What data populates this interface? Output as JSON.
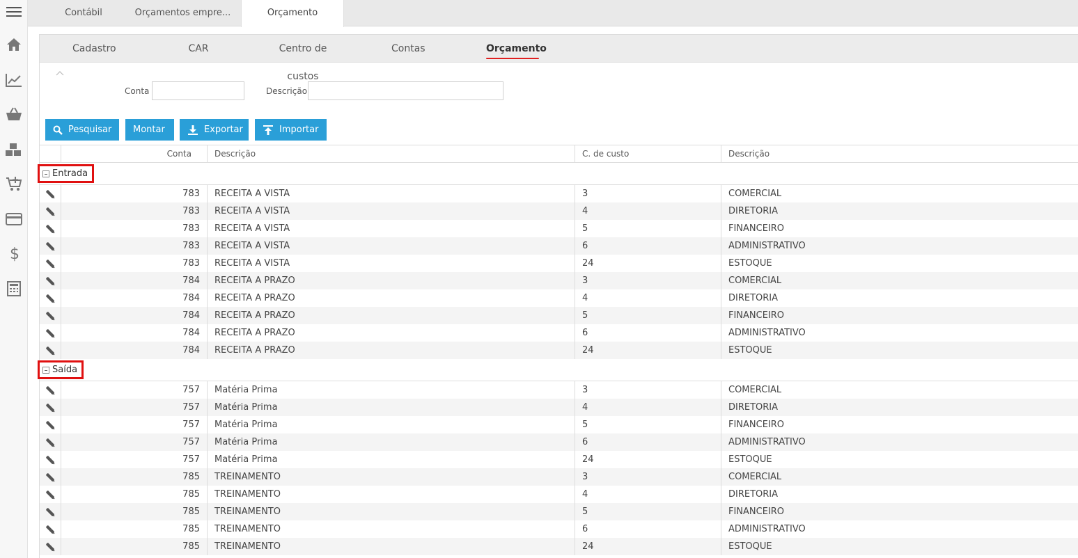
{
  "top_tabs": [
    {
      "label": "Contábil",
      "active": false
    },
    {
      "label": "Orçamentos empre...",
      "active": false
    },
    {
      "label": "Orçamento",
      "active": true
    }
  ],
  "sub_tabs": [
    {
      "label": "Cadastro",
      "active": false
    },
    {
      "label": "CAR",
      "active": false
    },
    {
      "label": "Centro de custos",
      "active": false
    },
    {
      "label": "Contas",
      "active": false
    },
    {
      "label": "Orçamento",
      "active": true
    }
  ],
  "sidebar_icons": [
    "menu-icon",
    "home-icon",
    "chart-icon",
    "basket-icon",
    "boxes-icon",
    "cart-plus-icon",
    "credit-card-icon",
    "dollar-icon",
    "calculator-icon"
  ],
  "filters": {
    "conta_label": "Conta",
    "conta_value": "",
    "descricao_label": "Descrição",
    "descricao_value": ""
  },
  "buttons": {
    "pesquisar": "Pesquisar",
    "montar": "Montar",
    "exportar": "Exportar",
    "importar": "Importar"
  },
  "colors": {
    "accent": "#2a9fd8",
    "highlight": "#e01010"
  },
  "columns": [
    "Conta",
    "Descrição",
    "C. de custo",
    "Descrição"
  ],
  "groups": [
    {
      "label": "Entrada",
      "rows": [
        {
          "conta": "783",
          "descricao": "RECEITA A VISTA",
          "custo": "3",
          "custo_desc": "COMERCIAL"
        },
        {
          "conta": "783",
          "descricao": "RECEITA A VISTA",
          "custo": "4",
          "custo_desc": "DIRETORIA"
        },
        {
          "conta": "783",
          "descricao": "RECEITA A VISTA",
          "custo": "5",
          "custo_desc": "FINANCEIRO"
        },
        {
          "conta": "783",
          "descricao": "RECEITA A VISTA",
          "custo": "6",
          "custo_desc": "ADMINISTRATIVO"
        },
        {
          "conta": "783",
          "descricao": "RECEITA A VISTA",
          "custo": "24",
          "custo_desc": "ESTOQUE"
        },
        {
          "conta": "784",
          "descricao": "RECEITA A PRAZO",
          "custo": "3",
          "custo_desc": "COMERCIAL"
        },
        {
          "conta": "784",
          "descricao": "RECEITA A PRAZO",
          "custo": "4",
          "custo_desc": "DIRETORIA"
        },
        {
          "conta": "784",
          "descricao": "RECEITA A PRAZO",
          "custo": "5",
          "custo_desc": "FINANCEIRO"
        },
        {
          "conta": "784",
          "descricao": "RECEITA A PRAZO",
          "custo": "6",
          "custo_desc": "ADMINISTRATIVO"
        },
        {
          "conta": "784",
          "descricao": "RECEITA A PRAZO",
          "custo": "24",
          "custo_desc": "ESTOQUE"
        }
      ]
    },
    {
      "label": "Saída",
      "rows": [
        {
          "conta": "757",
          "descricao": "Matéria Prima",
          "custo": "3",
          "custo_desc": "COMERCIAL"
        },
        {
          "conta": "757",
          "descricao": "Matéria Prima",
          "custo": "4",
          "custo_desc": "DIRETORIA"
        },
        {
          "conta": "757",
          "descricao": "Matéria Prima",
          "custo": "5",
          "custo_desc": "FINANCEIRO"
        },
        {
          "conta": "757",
          "descricao": "Matéria Prima",
          "custo": "6",
          "custo_desc": "ADMINISTRATIVO"
        },
        {
          "conta": "757",
          "descricao": "Matéria Prima",
          "custo": "24",
          "custo_desc": "ESTOQUE"
        },
        {
          "conta": "785",
          "descricao": "TREINAMENTO",
          "custo": "3",
          "custo_desc": "COMERCIAL"
        },
        {
          "conta": "785",
          "descricao": "TREINAMENTO",
          "custo": "4",
          "custo_desc": "DIRETORIA"
        },
        {
          "conta": "785",
          "descricao": "TREINAMENTO",
          "custo": "5",
          "custo_desc": "FINANCEIRO"
        },
        {
          "conta": "785",
          "descricao": "TREINAMENTO",
          "custo": "6",
          "custo_desc": "ADMINISTRATIVO"
        },
        {
          "conta": "785",
          "descricao": "TREINAMENTO",
          "custo": "24",
          "custo_desc": "ESTOQUE"
        }
      ]
    }
  ]
}
